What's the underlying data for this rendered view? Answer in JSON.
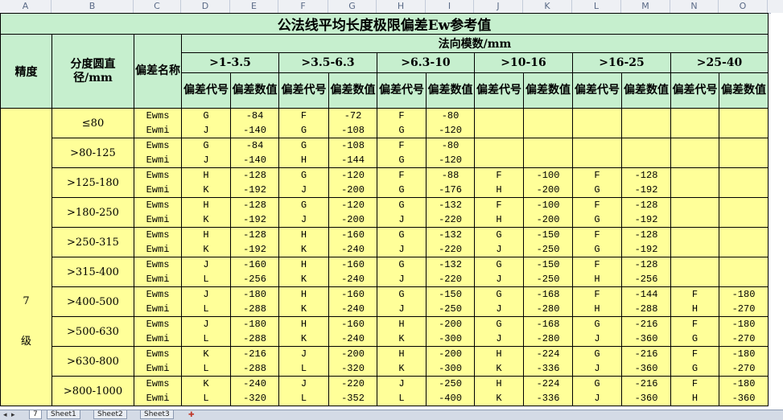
{
  "column_headers": [
    "A",
    "B",
    "C",
    "D",
    "E",
    "F",
    "G",
    "H",
    "I",
    "J",
    "K",
    "L",
    "M",
    "N",
    "O"
  ],
  "title": "公法线平均长度极限偏差Ew参考值",
  "headers": {
    "precision": "精度",
    "diameter": "分度圆直径/mm",
    "deviation_name": "偏差名称",
    "module": "法向模数/mm",
    "code": "偏差代号",
    "value": "偏差数值"
  },
  "modules": [
    ">1-3.5",
    ">3.5-6.3",
    ">6.3-10",
    ">10-16",
    ">16-25",
    ">25-40"
  ],
  "deviation_names": [
    "Ewms",
    "Ewmi"
  ],
  "grade": [
    "7",
    "级"
  ],
  "rows": [
    {
      "dia": "≤80",
      "cells": [
        [
          "G",
          "J",
          "-84",
          "-140"
        ],
        [
          "F",
          "G",
          "-72",
          "-108"
        ],
        [
          "F",
          "G",
          "-80",
          "-120"
        ],
        [
          "",
          "",
          "",
          ""
        ],
        [
          "",
          "",
          "",
          ""
        ],
        [
          "",
          "",
          "",
          ""
        ]
      ]
    },
    {
      "dia": ">80-125",
      "cells": [
        [
          "G",
          "J",
          "-84",
          "-140"
        ],
        [
          "G",
          "H",
          "-108",
          "-144"
        ],
        [
          "F",
          "G",
          "-80",
          "-120"
        ],
        [
          "",
          "",
          "",
          ""
        ],
        [
          "",
          "",
          "",
          ""
        ],
        [
          "",
          "",
          "",
          ""
        ]
      ]
    },
    {
      "dia": ">125-180",
      "cells": [
        [
          "H",
          "K",
          "-128",
          "-192"
        ],
        [
          "G",
          "J",
          "-120",
          "-200"
        ],
        [
          "F",
          "G",
          "-88",
          "-176"
        ],
        [
          "F",
          "H",
          "-100",
          "-200"
        ],
        [
          "F",
          "G",
          "-128",
          "-192"
        ],
        [
          "",
          "",
          "",
          ""
        ]
      ]
    },
    {
      "dia": ">180-250",
      "cells": [
        [
          "H",
          "K",
          "-128",
          "-192"
        ],
        [
          "G",
          "J",
          "-120",
          "-200"
        ],
        [
          "G",
          "J",
          "-132",
          "-220"
        ],
        [
          "F",
          "H",
          "-100",
          "-200"
        ],
        [
          "F",
          "G",
          "-128",
          "-192"
        ],
        [
          "",
          "",
          "",
          ""
        ]
      ]
    },
    {
      "dia": ">250-315",
      "cells": [
        [
          "H",
          "K",
          "-128",
          "-192"
        ],
        [
          "H",
          "K",
          "-160",
          "-240"
        ],
        [
          "G",
          "J",
          "-132",
          "-220"
        ],
        [
          "G",
          "J",
          "-150",
          "-250"
        ],
        [
          "F",
          "G",
          "-128",
          "-192"
        ],
        [
          "",
          "",
          "",
          ""
        ]
      ]
    },
    {
      "dia": ">315-400",
      "cells": [
        [
          "J",
          "L",
          "-160",
          "-256"
        ],
        [
          "H",
          "K",
          "-160",
          "-240"
        ],
        [
          "G",
          "J",
          "-132",
          "-220"
        ],
        [
          "G",
          "J",
          "-150",
          "-250"
        ],
        [
          "F",
          "H",
          "-128",
          "-256"
        ],
        [
          "",
          "",
          "",
          ""
        ]
      ]
    },
    {
      "dia": ">400-500",
      "cells": [
        [
          "J",
          "L",
          "-180",
          "-288"
        ],
        [
          "H",
          "K",
          "-160",
          "-240"
        ],
        [
          "G",
          "J",
          "-150",
          "-250"
        ],
        [
          "G",
          "J",
          "-168",
          "-280"
        ],
        [
          "F",
          "H",
          "-144",
          "-288"
        ],
        [
          "F",
          "H",
          "-180",
          "-270"
        ]
      ]
    },
    {
      "dia": ">500-630",
      "cells": [
        [
          "J",
          "L",
          "-180",
          "-288"
        ],
        [
          "H",
          "K",
          "-160",
          "-240"
        ],
        [
          "H",
          "K",
          "-200",
          "-300"
        ],
        [
          "G",
          "J",
          "-168",
          "-280"
        ],
        [
          "G",
          "J",
          "-216",
          "-360"
        ],
        [
          "F",
          "G",
          "-180",
          "-270"
        ]
      ]
    },
    {
      "dia": ">630-800",
      "cells": [
        [
          "K",
          "L",
          "-216",
          "-288"
        ],
        [
          "J",
          "L",
          "-200",
          "-320"
        ],
        [
          "H",
          "K",
          "-200",
          "-300"
        ],
        [
          "H",
          "K",
          "-224",
          "-336"
        ],
        [
          "G",
          "J",
          "-216",
          "-360"
        ],
        [
          "F",
          "G",
          "-180",
          "-270"
        ]
      ]
    },
    {
      "dia": ">800-1000",
      "cells": [
        [
          "K",
          "L",
          "-240",
          "-320"
        ],
        [
          "J",
          "L",
          "-220",
          "-352"
        ],
        [
          "J",
          "L",
          "-250",
          "-400"
        ],
        [
          "H",
          "K",
          "-224",
          "-336"
        ],
        [
          "G",
          "J",
          "-216",
          "-360"
        ],
        [
          "F",
          "H",
          "-180",
          "-360"
        ]
      ]
    }
  ],
  "sheet_tabs": [
    "7",
    "Sheet1",
    "Sheet2",
    "Sheet3"
  ],
  "colors": {
    "header_fill": "#c6efce",
    "body_fill": "#ffff99",
    "grid": "#000000"
  }
}
